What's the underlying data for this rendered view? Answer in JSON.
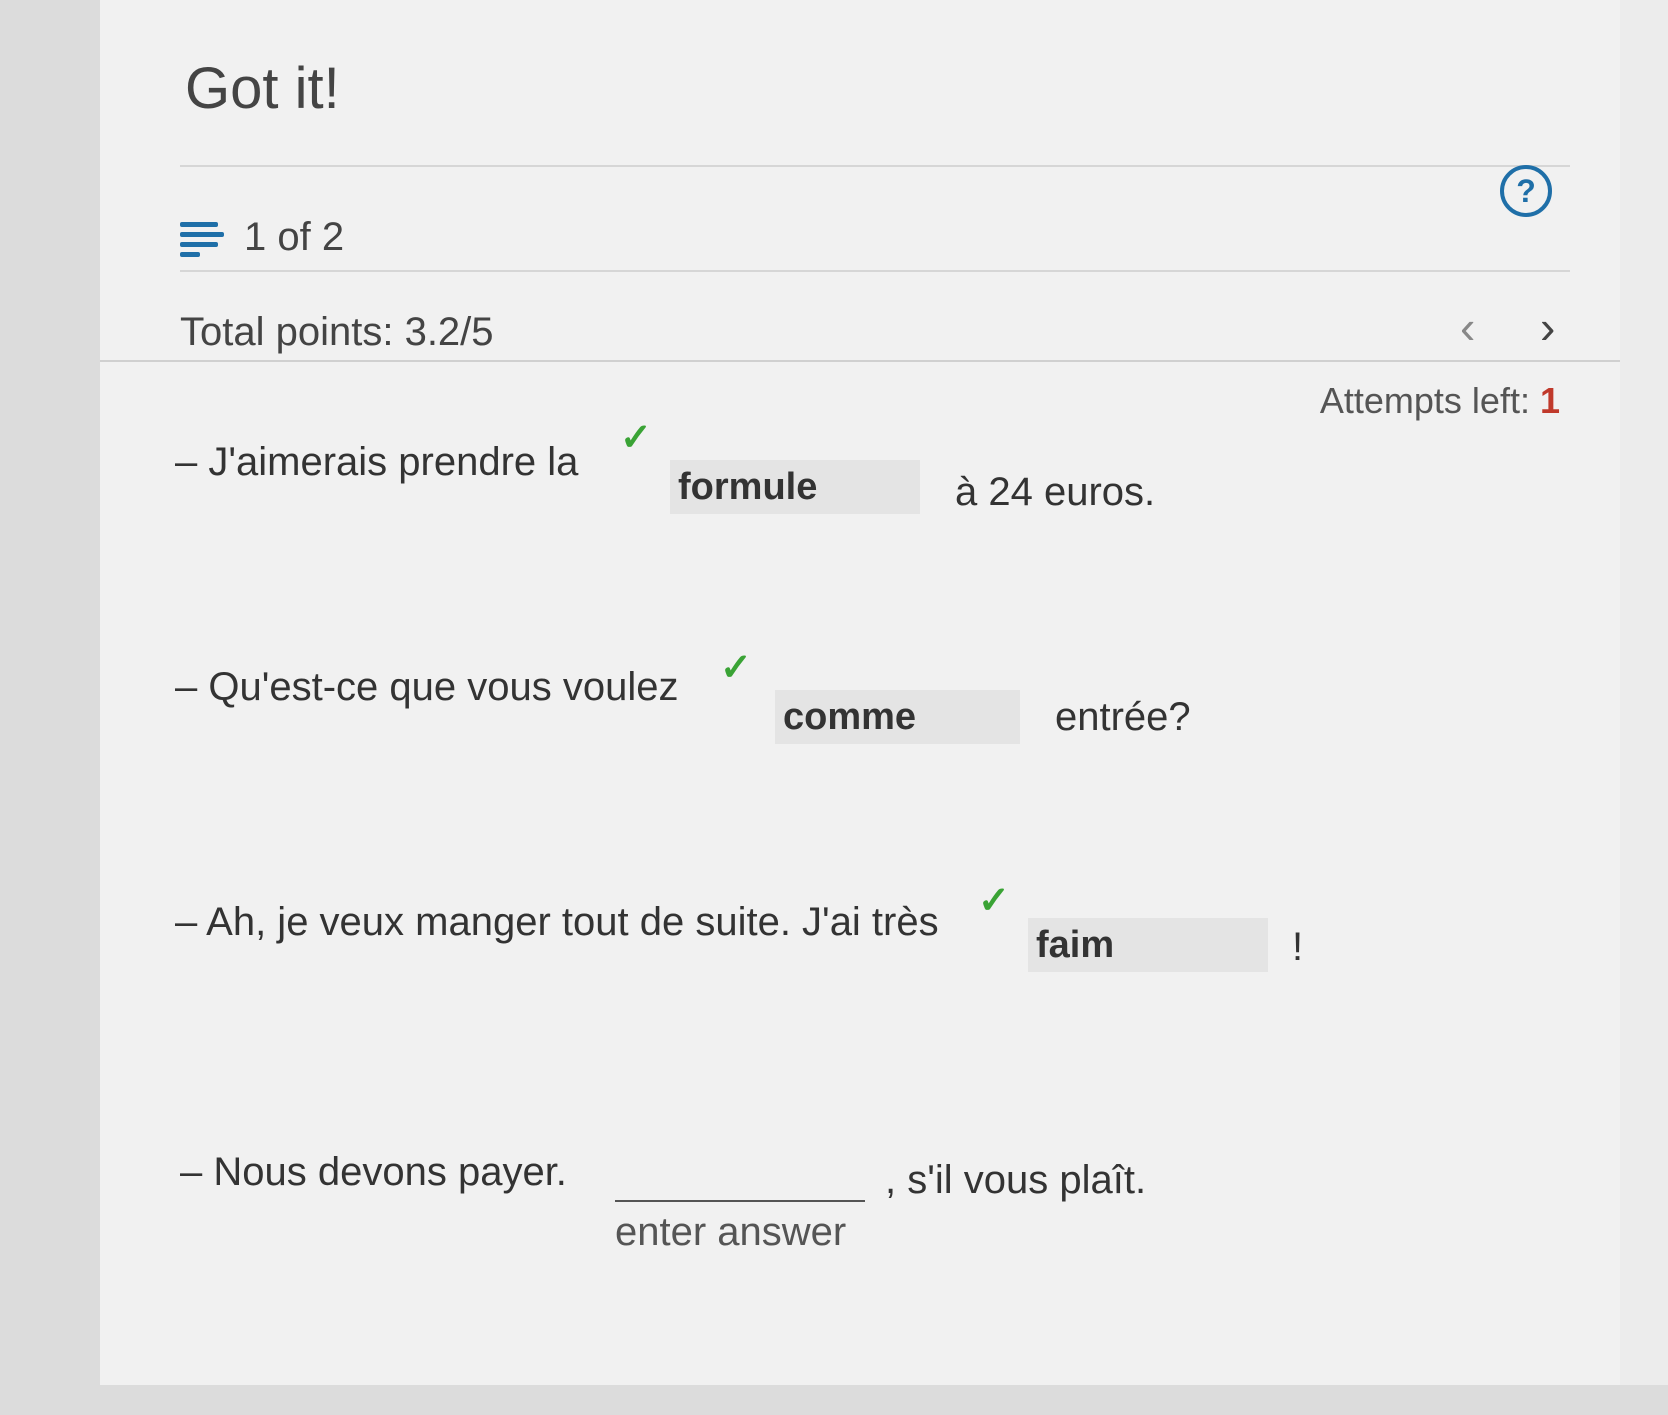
{
  "header": {
    "title": "Got it!",
    "counter": "1 of 2",
    "total_points": "Total points: 3.2/5",
    "attempts_label": "Attempts left:",
    "attempts_value": "1",
    "help_glyph": "?",
    "prev_glyph": "‹",
    "next_glyph": "›"
  },
  "questions": [
    {
      "before": "– J'aimerais prendre la",
      "answer": "formule",
      "after": "à 24 euros.",
      "status": "correct"
    },
    {
      "before": "– Qu'est-ce que vous voulez",
      "answer": "comme",
      "after": "entrée?",
      "status": "correct"
    },
    {
      "before": "– Ah, je veux manger tout de suite. J'ai très",
      "answer": "faim",
      "after": "!",
      "status": "correct"
    },
    {
      "before": "– Nous devons payer.",
      "answer": "",
      "placeholder": "enter answer",
      "after": ", s'il vous plaît.",
      "status": "pending"
    }
  ],
  "check_glyph": "✓",
  "colors": {
    "accent": "#1f6fa8",
    "correct": "#3aa335",
    "attempts": "#c0392b"
  }
}
